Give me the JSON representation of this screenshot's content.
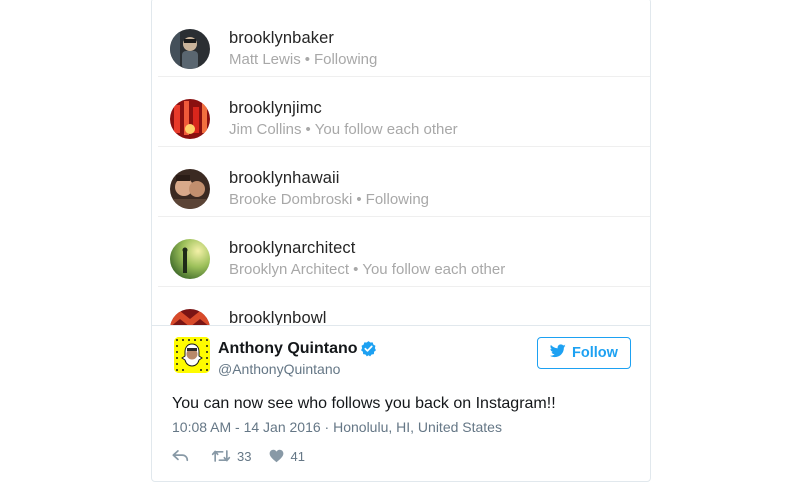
{
  "instagram_list": {
    "rows": [
      {
        "username": "brooklynbaker",
        "name": "Matt Lewis",
        "status": "Following",
        "avatar_icon": "avatar-photo-man-dark"
      },
      {
        "username": "brooklynjimc",
        "name": "Jim Collins",
        "status": "You follow each other",
        "avatar_icon": "avatar-photo-red-lights"
      },
      {
        "username": "brooklynhawaii",
        "name": "Brooke Dombroski",
        "status": "Following",
        "avatar_icon": "avatar-photo-selfie"
      },
      {
        "username": "brooklynarchitect",
        "name": "Brooklyn Architect",
        "status": "You follow each other",
        "avatar_icon": "avatar-photo-silhouette-green"
      },
      {
        "username": "brooklynbowl",
        "name": "",
        "status": "",
        "avatar_icon": "avatar-photo-red-pattern"
      }
    ],
    "separator": "•"
  },
  "tweet": {
    "display_name": "Anthony Quintano",
    "handle": "@AnthonyQuintano",
    "verified_icon": "verified-badge-icon",
    "follow_label": "Follow",
    "text": "You can now see who follows you back on Instagram!!",
    "meta": "10:08 AM - 14 Jan 2016 · Honolulu, HI, United States",
    "retweets": "33",
    "likes": "41"
  },
  "colors": {
    "twitter_blue": "#1da1f2",
    "snapchat_yellow": "#fffc00",
    "ig_text": "#262626",
    "ig_sub": "#a8a8a8"
  }
}
